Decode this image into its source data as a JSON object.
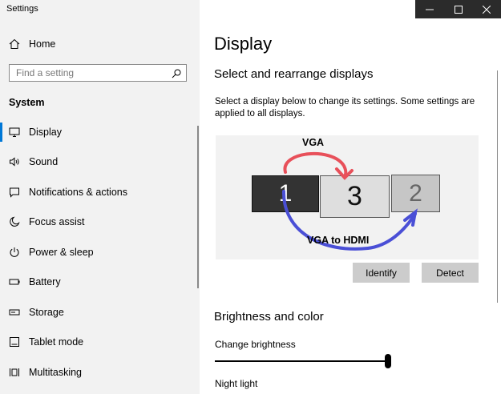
{
  "window": {
    "title": "Settings"
  },
  "sidebar": {
    "home_label": "Home",
    "search_placeholder": "Find a setting",
    "section": "System",
    "items": [
      {
        "label": "Display",
        "icon": "monitor-icon"
      },
      {
        "label": "Sound",
        "icon": "speaker-icon"
      },
      {
        "label": "Notifications & actions",
        "icon": "message-icon"
      },
      {
        "label": "Focus assist",
        "icon": "moon-icon"
      },
      {
        "label": "Power & sleep",
        "icon": "power-icon"
      },
      {
        "label": "Battery",
        "icon": "battery-icon"
      },
      {
        "label": "Storage",
        "icon": "storage-icon"
      },
      {
        "label": "Tablet mode",
        "icon": "tablet-icon"
      },
      {
        "label": "Multitasking",
        "icon": "multitask-icon"
      }
    ],
    "selected": "Display"
  },
  "main": {
    "title": "Display",
    "section_title": "Select and rearrange displays",
    "description": "Select a display below to change its settings. Some settings are applied to all displays.",
    "monitors": [
      "1",
      "3",
      "2"
    ],
    "annotations": {
      "top": "VGA",
      "bottom": "VGA to HDMI"
    },
    "identify_label": "Identify",
    "detect_label": "Detect",
    "brightness_title": "Brightness and color",
    "brightness_label": "Change brightness",
    "brightness_value": 1.0,
    "night_light_label": "Night light"
  },
  "colors": {
    "accent": "#0078d7",
    "annotation_red": "#e8505a",
    "annotation_blue": "#4a4fd6"
  }
}
